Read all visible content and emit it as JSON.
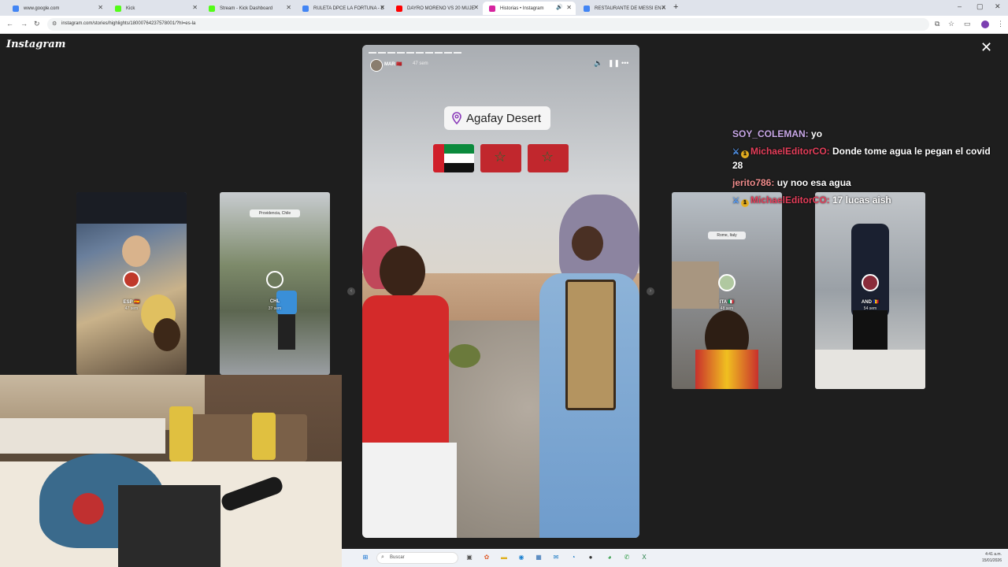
{
  "browser": {
    "tabs": [
      {
        "title": "www.google.com",
        "color": "#4285f4"
      },
      {
        "title": "Kick",
        "color": "#53fc18"
      },
      {
        "title": "Stream - Kick Dashboard",
        "color": "#53fc18"
      },
      {
        "title": "RULETA DPCE LA FORTUNA - B",
        "color": "#4285f4"
      },
      {
        "title": "DAYRO MORENO VS 20 MUJE",
        "color": "#ff0000"
      },
      {
        "title": "Historias • Instagram",
        "color": "#d6249f"
      },
      {
        "title": "RESTAURANTE DE MESSI EN A",
        "color": "#4285f4"
      }
    ],
    "active_tab_index": 5,
    "new_tab": "+",
    "url": "instagram.com/stories/highlights/18000764237578001/?hl=es-la"
  },
  "instagram": {
    "logo": "Instagram",
    "close": "✕",
    "thumbnails_left": [
      {
        "user": "ESP",
        "verified": "🇪🇸",
        "age": "47 sem"
      },
      {
        "user": "CHL",
        "verified": "",
        "age": "37 sem",
        "location": "Providencia, Chile"
      }
    ],
    "thumbnails_right": [
      {
        "user": "ITA",
        "verified": "🇮🇹",
        "age": "48 sem",
        "location": "Rome, Italy"
      },
      {
        "user": "AND",
        "verified": "🇦🇩",
        "age": "54 sem"
      }
    ],
    "story": {
      "user": "MAR",
      "flag": "🇲🇦",
      "time": "47 sem",
      "location": "Agafay Desert",
      "flags": [
        "UAE",
        "Morocco",
        "Morocco"
      ],
      "progress_segments": 10
    }
  },
  "chat": {
    "messages": [
      {
        "user": "SOY_COLEMAN:",
        "text": "yo"
      },
      {
        "user": "MichaelEditorCO:",
        "text": "Donde tome agua le pegan el covid 28"
      },
      {
        "user": "jerito786:",
        "text": "uy noo esa agua"
      },
      {
        "user": "MichaelEditorCO:",
        "text": "17 lucas aish"
      }
    ]
  },
  "taskbar": {
    "search_placeholder": "Buscar",
    "time": "4:41 a.m.",
    "date": "15/01/2026"
  }
}
